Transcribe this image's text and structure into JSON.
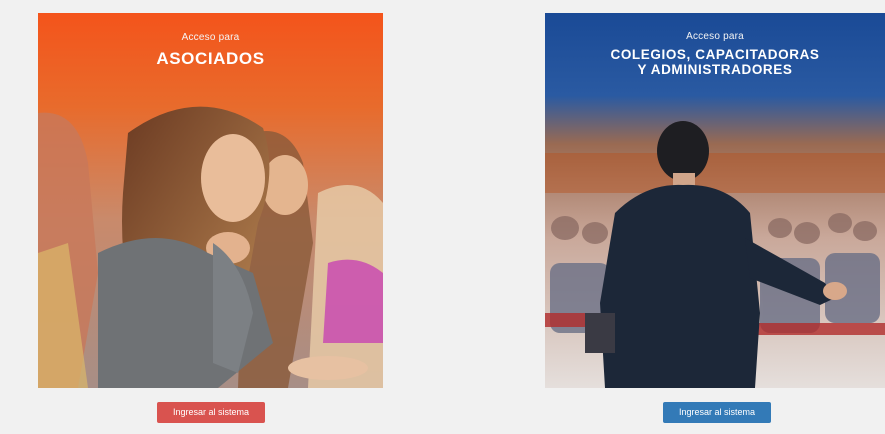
{
  "left_card": {
    "subtitle": "Acceso para",
    "title": "ASOCIADOS",
    "button_label": "Ingresar al sistema"
  },
  "right_card": {
    "subtitle": "Acceso para",
    "title_line1": "COLEGIOS, CAPACITADORAS",
    "title_line2": "Y ADMINISTRADORES",
    "button_label": "Ingresar al sistema"
  },
  "colors": {
    "left_accent": "#f0621f",
    "left_button": "#d9534f",
    "right_accent": "#1b4b93",
    "right_button": "#337ab7",
    "page_bg": "#f1f1f1"
  }
}
